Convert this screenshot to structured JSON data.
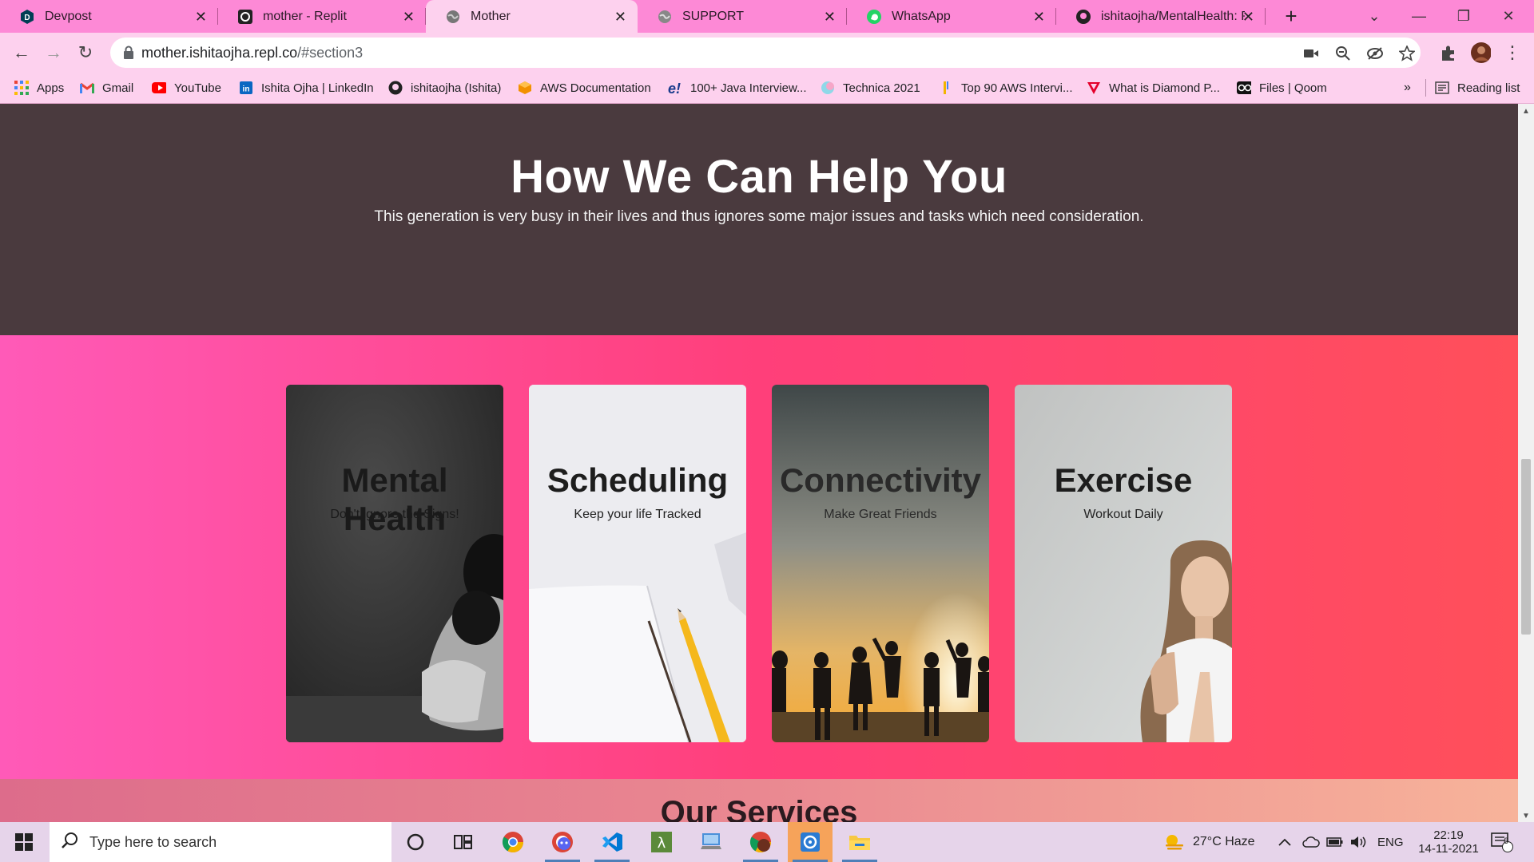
{
  "browser": {
    "tabs": [
      {
        "title": "Devpost",
        "icon": "devpost-icon",
        "active": false
      },
      {
        "title": "mother - Replit",
        "icon": "replit-icon",
        "active": false
      },
      {
        "title": "Mother",
        "icon": "globe-icon",
        "active": true
      },
      {
        "title": "SUPPORT",
        "icon": "globe-icon",
        "active": false
      },
      {
        "title": "WhatsApp",
        "icon": "whatsapp-icon",
        "active": false
      },
      {
        "title": "ishitaojha/MentalHealth: Pc",
        "icon": "github-icon",
        "active": false
      }
    ],
    "url_host": "mother.ishitaojha.repl.co",
    "url_path": "/#section3",
    "bookmarks": [
      {
        "label": "Apps",
        "icon": "apps-grid-icon"
      },
      {
        "label": "Gmail",
        "icon": "gmail-icon"
      },
      {
        "label": "YouTube",
        "icon": "youtube-icon"
      },
      {
        "label": "Ishita Ojha | LinkedIn",
        "icon": "linkedin-icon"
      },
      {
        "label": "ishitaojha (Ishita)",
        "icon": "github-icon"
      },
      {
        "label": "AWS Documentation",
        "icon": "aws-icon"
      },
      {
        "label": "100+ Java Interview...",
        "icon": "edureka-icon"
      },
      {
        "label": "Technica 2021",
        "icon": "technica-icon"
      },
      {
        "label": "Top 90 AWS Intervi...",
        "icon": "bookmark-icon"
      },
      {
        "label": "What is Diamond P...",
        "icon": "diamond-icon"
      },
      {
        "label": "Files | Qoom",
        "icon": "qoom-icon"
      }
    ],
    "bookmarks_overflow": "»",
    "reading_list": "Reading list"
  },
  "page": {
    "help_title": "How We Can Help You",
    "help_text": "This generation is very busy in their lives and thus ignores some major issues and tasks which need consideration.",
    "cards": [
      {
        "title": "Mental Health",
        "subtitle": "Don't ignore the Signs!"
      },
      {
        "title": "Scheduling",
        "subtitle": "Keep your life Tracked"
      },
      {
        "title": "Connectivity",
        "subtitle": "Make Great Friends"
      },
      {
        "title": "Exercise",
        "subtitle": "Workout Daily"
      }
    ],
    "services_title": "Our Services",
    "colors": {
      "help_bg": "#4a3a3e",
      "cards_gradient": [
        "#ff5ab8",
        "#ff3f7a",
        "#ff4f5a"
      ],
      "services_gradient": [
        "#dd6c8b",
        "#f7b39a"
      ]
    }
  },
  "taskbar": {
    "search_placeholder": "Type here to search",
    "weather": "27°C  Haze",
    "language": "ENG",
    "time": "22:19",
    "date": "14-11-2021",
    "notifications": "6",
    "apps": [
      "cortana-icon",
      "task-view-icon",
      "chrome-icon",
      "discord-chrome-icon",
      "vscode-icon",
      "terminal-icon",
      "network-icon",
      "chrome-profile-icon",
      "screen-recorder-icon",
      "file-explorer-icon"
    ]
  }
}
